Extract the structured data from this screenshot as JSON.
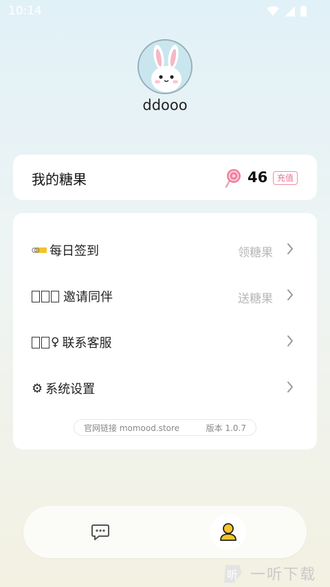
{
  "status_bar": {
    "time": "10:14"
  },
  "profile": {
    "username": "ddooo"
  },
  "candy": {
    "title": "我的糖果",
    "count": "46",
    "recharge_label": "充值"
  },
  "menu": {
    "items": [
      {
        "label": "每日签到",
        "hint": "领糖果"
      },
      {
        "label": "邀请同伴",
        "hint": "送糖果"
      },
      {
        "label": "联系客服",
        "hint": ""
      },
      {
        "label": "系统设置",
        "hint": ""
      }
    ]
  },
  "footer": {
    "site": "官网链接 momood.store",
    "version": "版本 1.0.7"
  },
  "watermark": {
    "text": "一听下载"
  },
  "colors": {
    "accent_pink": "#e8708e",
    "background_top": "#e1f1f8",
    "background_bottom": "#f3f1e2"
  }
}
